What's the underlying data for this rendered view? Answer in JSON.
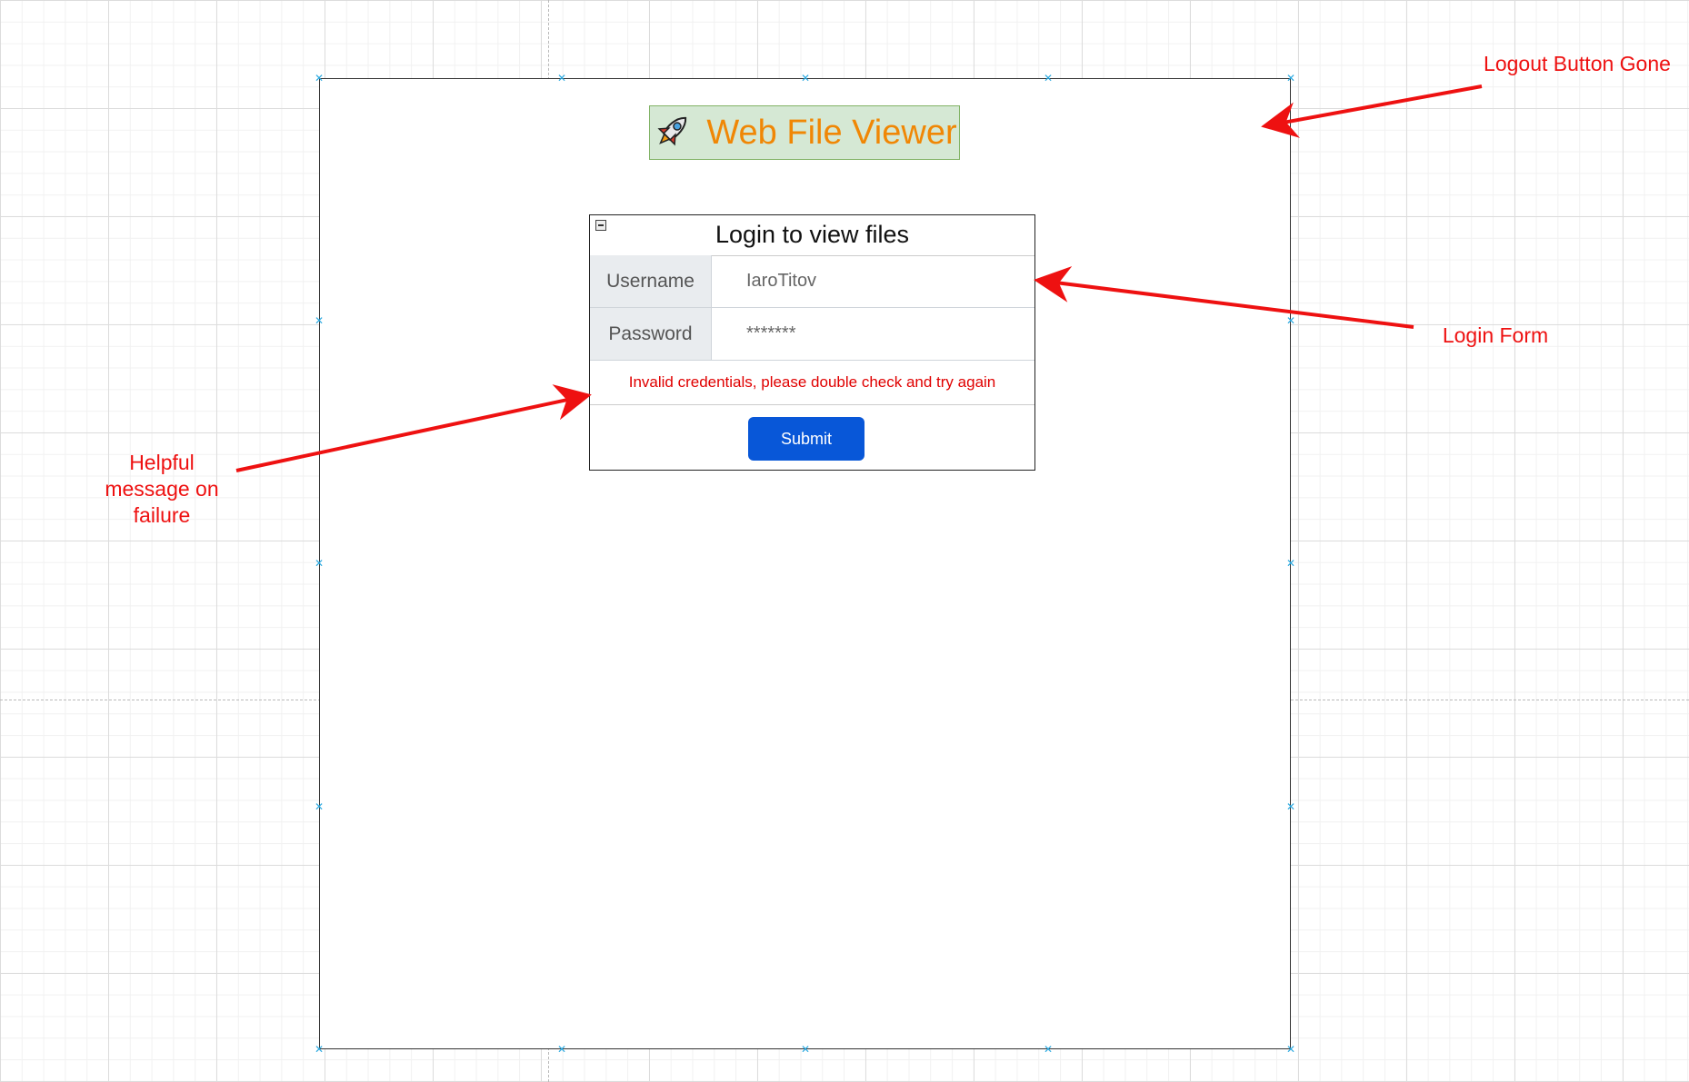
{
  "app": {
    "title": "Web File Viewer",
    "logo_icon": "rocket-icon"
  },
  "login_form": {
    "heading": "Login to view files",
    "collapse_icon": "collapse-icon",
    "username_label": "Username",
    "username_value": "IaroTitov",
    "password_label": "Password",
    "password_value": "*******",
    "error_message": "Invalid credentials, please double check and try again",
    "submit_label": "Submit"
  },
  "annotations": {
    "logout": "Logout Button Gone",
    "login_form": "Login Form",
    "helpful_message": "Helpful message on failure"
  },
  "colors": {
    "annotation": "#ee1111",
    "title_text": "#f08705",
    "title_bg": "#d5e8d4",
    "submit_bg": "#0857d8",
    "error_text": "#e00000"
  }
}
